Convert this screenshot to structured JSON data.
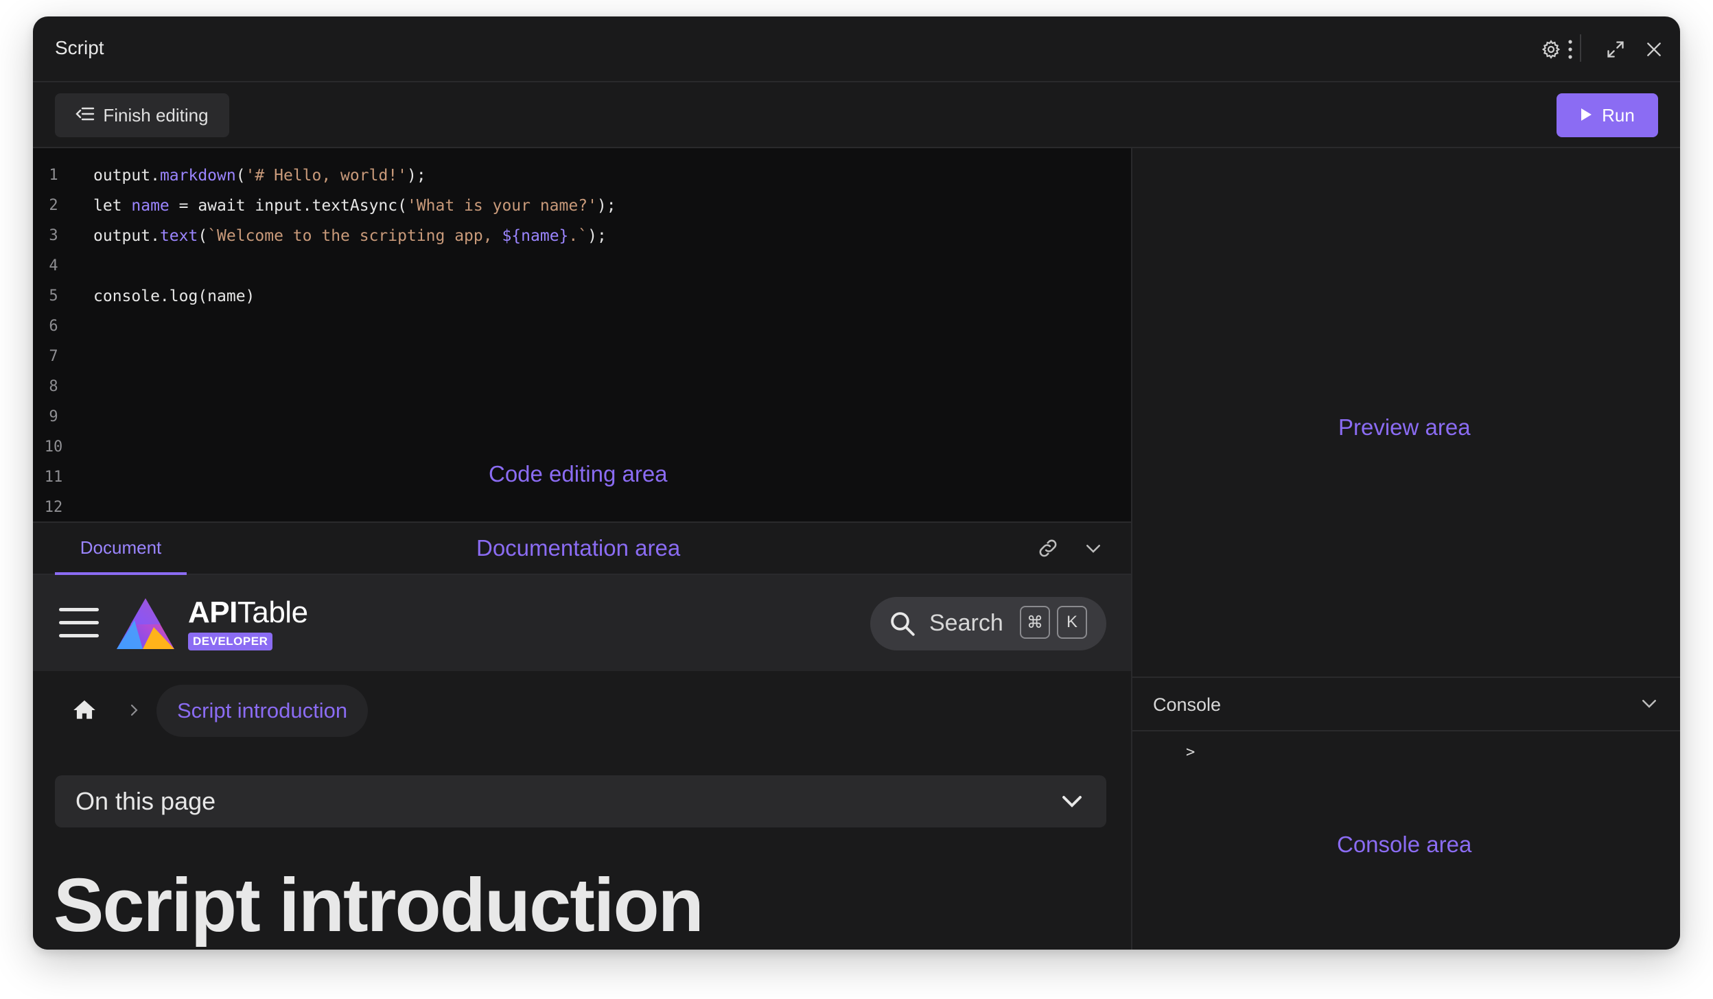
{
  "window": {
    "title": "Script",
    "icons": [
      "gear-icon",
      "more-vertical-icon",
      "expand-icon",
      "close-icon"
    ]
  },
  "toolbar": {
    "finish_label": "Finish editing",
    "run_label": "Run",
    "accent_color": "#8b6cf3"
  },
  "editor": {
    "area_label": "Code editing area",
    "line_numbers": [
      "1",
      "2",
      "3",
      "4",
      "5",
      "6",
      "7",
      "8",
      "9",
      "10",
      "11",
      "12"
    ],
    "lines": [
      [
        {
          "t": "output."
        },
        {
          "t": "markdown",
          "c": "purple"
        },
        {
          "t": "("
        },
        {
          "t": "'# Hello, world!'",
          "c": "string"
        },
        {
          "t": ");"
        }
      ],
      [
        {
          "t": "let "
        },
        {
          "t": "name",
          "c": "purple"
        },
        {
          "t": " = await input.textAsync("
        },
        {
          "t": "'What is your name?'",
          "c": "string"
        },
        {
          "t": ");"
        }
      ],
      [
        {
          "t": "output."
        },
        {
          "t": "text",
          "c": "purple"
        },
        {
          "t": "("
        },
        {
          "t": "`Welcome to the scripting app, ",
          "c": "string"
        },
        {
          "t": "${name}",
          "c": "purple"
        },
        {
          "t": ".`",
          "c": "string"
        },
        {
          "t": ");"
        }
      ],
      [],
      [
        {
          "t": "console.log(name)"
        }
      ],
      [],
      [],
      [],
      [],
      [],
      [],
      []
    ]
  },
  "docs": {
    "tab_label": "Document",
    "area_label": "Documentation area",
    "brand_api": "API",
    "brand_table": "Table",
    "brand_badge": "DEVELOPER",
    "search_label": "Search",
    "search_keys": [
      "⌘",
      "K"
    ],
    "breadcrumb_current": "Script introduction",
    "on_this_page": "On this page",
    "heading": "Script introduction"
  },
  "preview": {
    "area_label": "Preview area"
  },
  "console": {
    "title": "Console",
    "prompt": ">",
    "area_label": "Console area"
  }
}
